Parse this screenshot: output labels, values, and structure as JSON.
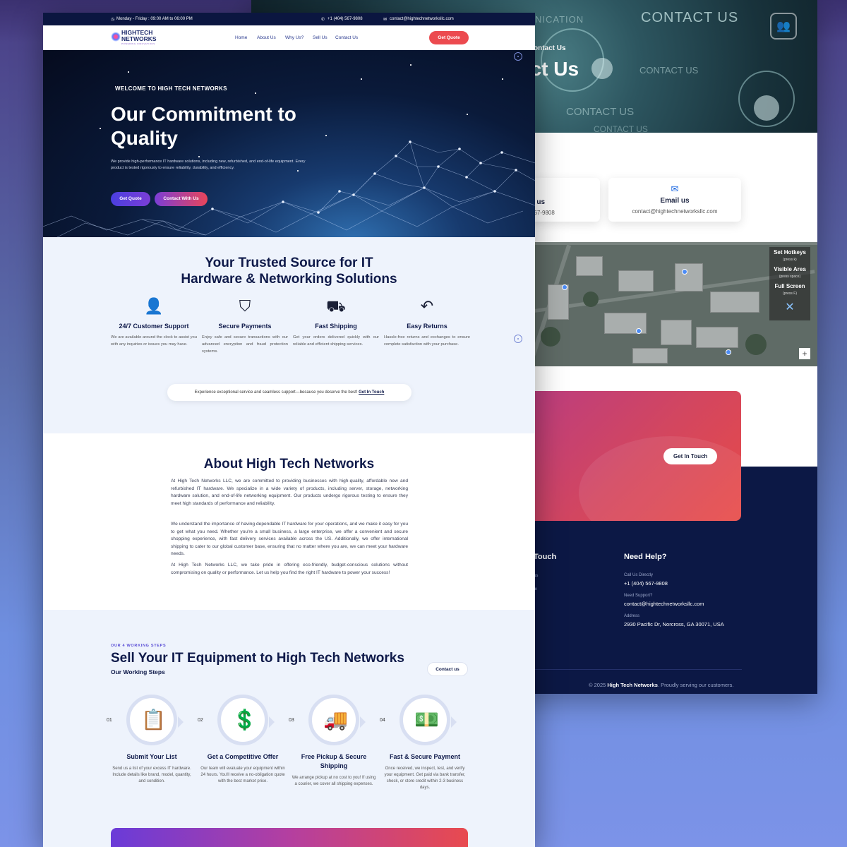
{
  "colors": {
    "accent": "#ec4a4f",
    "navy": "#0b1640",
    "purple": "#6a3bd8"
  },
  "back": {
    "hero_words": [
      "NICATION",
      "CONTACT US",
      "CONTACT US",
      "CONTACT US",
      "CONTACT US"
    ],
    "breadcrumb": "ontact Us",
    "hero_title": "act Us",
    "cards": [
      {
        "icon": "phone-icon",
        "title": "ll us",
        "value": "567-9808"
      },
      {
        "icon": "envelope-icon",
        "title": "Email us",
        "value": "contact@hightechnetworksllc.com"
      }
    ],
    "map_controls": {
      "hotkeys": "Set Hotkeys",
      "hotkeys_sub": "(press k)",
      "visible": "Visible Area",
      "visible_sub": "(press space)",
      "full": "Full Screen",
      "full_sub": "(press F)",
      "close": "✕",
      "zoom": "+"
    },
    "cta": {
      "kicker": "s.",
      "title": "te",
      "button": "Get In Touch"
    },
    "footer": {
      "left_heading": "Touch",
      "left_items": [
        "us",
        "te"
      ],
      "help_heading": "Need Help?",
      "items": [
        {
          "label": "Call Us Directly",
          "value": "+1 (404) 567-9808"
        },
        {
          "label": "Need Support?",
          "value": "contact@hightechnetworksllc.com"
        },
        {
          "label": "Address",
          "value": "2930 Pacific Dr, Norcross, GA 30071, USA"
        }
      ],
      "copyright_pre": "© 2025 ",
      "copyright_brand": "High Tech Networks",
      "copyright_post": ". Proudly serving our customers."
    }
  },
  "topbar": {
    "hours": "Monday - Friday : 09:00 AM to 06:00 PM",
    "phone": "+1 (404) 567-9808",
    "email": "contact@hightechnetworksllc.com"
  },
  "nav": {
    "logo_line1": "HIGHTECH",
    "logo_line2": "NETWORKS",
    "logo_tagline": "POWERING INNOVATIONS",
    "links": [
      "Home",
      "About Us",
      "Why Us?",
      "Sell Us",
      "Contact Us"
    ],
    "cta": "Get Quote"
  },
  "hero": {
    "eyebrow": "WELCOME TO HIGH TECH NETWORKS",
    "title": "Our Commitment to Quality",
    "description": "We provide high-performance IT hardware solutions, including new, refurbished, and end-of-life equipment. Every product is tested rigorously to ensure reliability, durability, and efficiency.",
    "btn_quote": "Get Quote",
    "btn_contact": "Contact With Us"
  },
  "trusted": {
    "title_line1": "Your Trusted Source for IT",
    "title_line2": "Hardware & Networking Solutions",
    "features": [
      {
        "icon": "support-agent-icon",
        "title": "24/7 Customer Support",
        "desc": "We are available around the clock to assist you with any inquiries or issues you may have."
      },
      {
        "icon": "shield-icon",
        "title": "Secure Payments",
        "desc": "Enjoy safe and secure transactions with our advanced encryption and fraud protection systems."
      },
      {
        "icon": "truck-icon",
        "title": "Fast Shipping",
        "desc": "Get your orders delivered quickly with our reliable and efficient shipping services."
      },
      {
        "icon": "return-arrow-icon",
        "title": "Easy Returns",
        "desc": "Hassle-free returns and exchanges to ensure complete satisfaction with your purchase."
      }
    ],
    "banner_text": "Experience exceptional service and seamless support—because you deserve the best! ",
    "banner_link": "Get In Touch"
  },
  "about": {
    "title": "About High Tech Networks",
    "paragraphs": [
      "At High Tech Networks LLC, we are committed to providing businesses with high-quality, affordable new and refurbished IT hardware. We specialize in a wide variety of products, including server, storage, networking hardware solution, and end-of-life networking equipment. Our products undergo rigorous testing to ensure they meet high standards of performance and reliability.",
      "We understand the importance of having dependable IT hardware for your operations, and we make it easy for you to get what you need. Whether you're a small business, a large enterprise, we offer a convenient and secure shopping experience, with fast delivery services available across the US. Additionally, we offer international shipping to cater to our global customer base, ensuring that no matter where you are, we can meet your hardware needs.",
      "At High Tech Networks LLC, we take pride in offering eco-friendly, budget-conscious solutions without compromising on quality or performance. Let us help you find the right IT hardware to power your success!"
    ]
  },
  "steps": {
    "eyebrow": "OUR 4 WORKING STEPS",
    "title": "Sell Your IT Equipment to High Tech Networks",
    "subtitle": "Our Working Steps",
    "button": "Contact us",
    "items": [
      {
        "num": "01",
        "icon": "clipboard-icon",
        "glyph": "📋",
        "title": "Submit Your List",
        "desc": "Send us a list of your excess IT hardware. Include details like brand, model, quantity, and condition."
      },
      {
        "num": "02",
        "icon": "money-hand-icon",
        "glyph": "💲",
        "title": "Get a Competitive Offer",
        "desc": "Our team will evaluate your equipment within 24 hours. You'll receive a no-obligation quote with the best market price."
      },
      {
        "num": "03",
        "icon": "delivery-truck-icon",
        "glyph": "🚚",
        "title": "Free Pickup & Secure Shipping",
        "desc": "We arrange pickup at no cost to you! If using a courier, we cover all shipping expenses."
      },
      {
        "num": "04",
        "icon": "payment-transfer-icon",
        "glyph": "💵",
        "title": "Fast & Secure Payment",
        "desc": "Once received, we inspect, test, and verify your equipment. Get paid via bank transfer, check, or store credit within 2-3 business days."
      }
    ]
  }
}
